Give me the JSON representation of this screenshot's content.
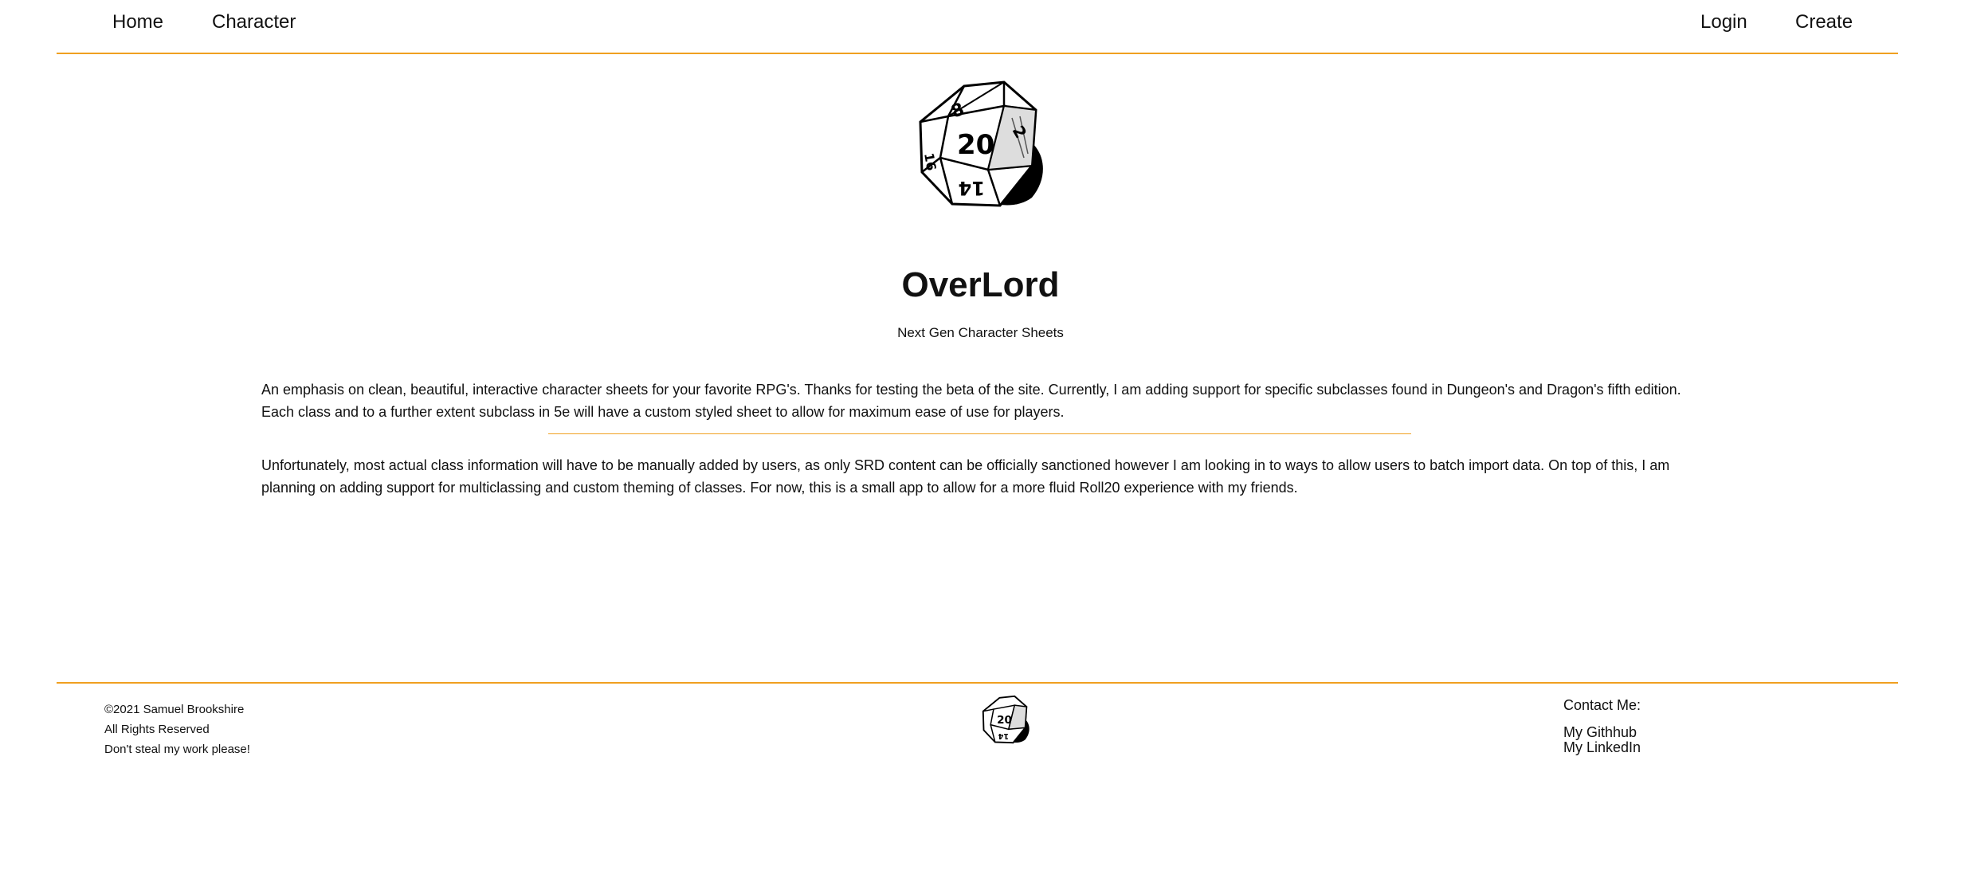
{
  "nav": {
    "home": "Home",
    "character": "Character",
    "login": "Login",
    "create": "Create"
  },
  "hero": {
    "title": "OverLord",
    "subtitle": "Next Gen Character Sheets",
    "logo_icon": "d20-dice-icon"
  },
  "content": {
    "paragraph1": "An emphasis on clean, beautiful, interactive character sheets for your favorite RPG's. Thanks for testing the beta of the site. Currently, I am adding support for specific subclasses found in Dungeon's and Dragon's fifth edition. Each class and to a further extent subclass in 5e will have a custom styled sheet to allow for maximum ease of use for players.",
    "paragraph2": "Unfortunately, most actual class information will have to be manually added by users, as only SRD content can be officially sanctioned however I am looking in to ways to allow users to batch import data. On top of this, I am planning on adding support for multiclassing and custom theming of classes. For now, this is a small app to allow for a more fluid Roll20 experience with my friends."
  },
  "footer": {
    "copyright": "©2021 Samuel Brookshire",
    "rights": "All Rights Reserved",
    "note": "Don't steal my work please!",
    "contact_title": "Contact Me:",
    "github": "My Githhub",
    "linkedin": "My LinkedIn"
  },
  "colors": {
    "accent": "#f0a020",
    "text": "#111111",
    "background": "#ffffff"
  }
}
